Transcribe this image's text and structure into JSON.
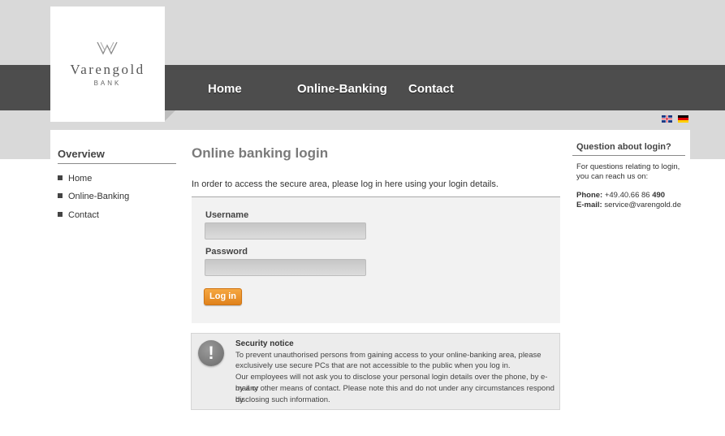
{
  "logo": {
    "name": "Varengold",
    "sub": "BANK"
  },
  "nav": {
    "home": "Home",
    "online_banking": "Online-Banking",
    "contact": "Contact"
  },
  "languages": [
    "english-flag-icon",
    "german-flag-icon"
  ],
  "sidebar": {
    "title": "Overview",
    "items": [
      {
        "label": "Home"
      },
      {
        "label": "Online-Banking"
      },
      {
        "label": "Contact"
      }
    ]
  },
  "main": {
    "title": "Online banking login",
    "intro": "In order to access the secure area, please log in here using your login details.",
    "username_label": "Username",
    "username_value": "",
    "password_label": "Password",
    "password_value": "",
    "login_button": "Log in"
  },
  "notice": {
    "icon": "exclamation-icon",
    "title": "Security notice",
    "line1": "To prevent unauthorised persons from gaining access to your online-banking area, please",
    "line2": "exclusively use secure PCs that are not accessible to the public when you log in.",
    "line3": "Our employees will not ask you to disclose your personal login details over the phone, by e-mail or",
    "line4": "by any other means of contact. Please note this and do not under any circumstances respond by",
    "line5": "disclosing such information."
  },
  "help": {
    "title": "Question about login?",
    "text": "For questions relating to login, you can reach us on:",
    "phone_label": "Phone:",
    "phone_value": "+49.40.66 86",
    "phone_ext": "490",
    "email_label": "E-mail:",
    "email_value": "service@varengold.de"
  },
  "colors": {
    "nav_bg": "#4d4d4d",
    "band_bg": "#d9d9d9",
    "accent_orange": "#e8901f",
    "form_bg": "#f2f2f2"
  }
}
